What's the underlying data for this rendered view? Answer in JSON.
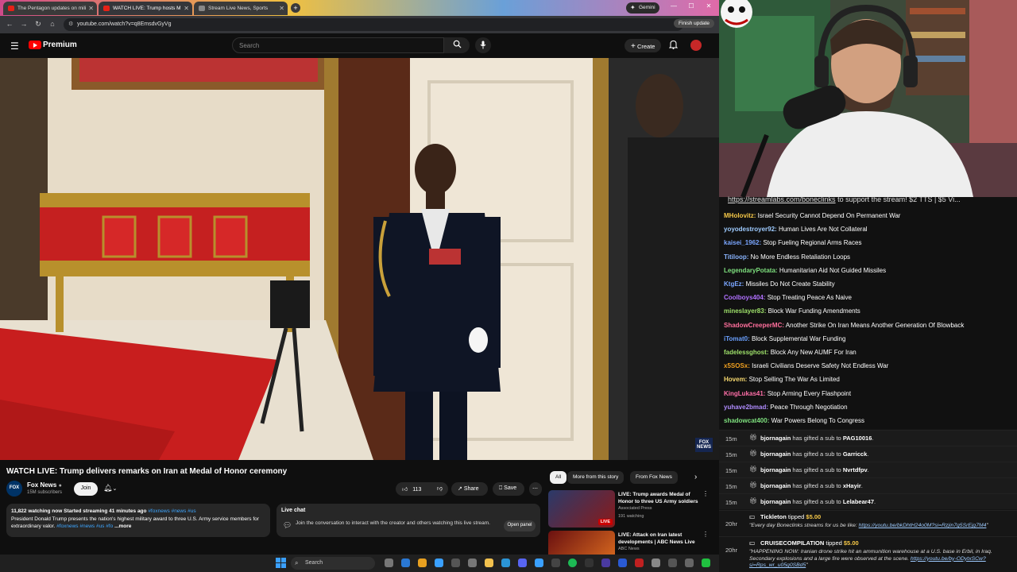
{
  "browser": {
    "tabs": [
      {
        "label": "The Pentagon updates on mili"
      },
      {
        "label": "WATCH LIVE: Trump hosts M"
      },
      {
        "label": "Stream Live News, Sports"
      }
    ],
    "gemini_label": "Gemini",
    "url": "youtube.com/watch?v=q8EmsdvGyVg",
    "finish_update": "Finish update"
  },
  "youtube": {
    "logo_text": "Premium",
    "search_placeholder": "Search",
    "create_label": "Create",
    "video": {
      "title": "WATCH LIVE: Trump delivers remarks on Iran at Medal of Honor ceremony",
      "channel": "Fox News",
      "subscribers": "15M subscribers",
      "join_label": "Join",
      "likes": "113",
      "share_label": "Share",
      "save_label": "Save",
      "description_meta": "11,822 watching now  Started streaming 41 minutes ago",
      "description_meta_tags": "#foxnews #news #us",
      "description_text": "President Donald Trump presents the nation's highest military award to three U.S. Army service members for extraordinary valor.",
      "description_tags": "#foxnews #news #us #fo",
      "description_more": "...more",
      "bug_text": "FOX NEWS"
    },
    "live_chat": {
      "title": "Live chat",
      "text": "Join the conversation to interact with the creator and others watching this live stream.",
      "open_panel": "Open panel"
    },
    "chips": [
      "All",
      "More from this story",
      "From Fox News"
    ],
    "recommendations": [
      {
        "title": "LIVE: Trump awards Medal of Honor to three US Army soldiers",
        "channel": "Associated Press",
        "watching": "191 watching",
        "badge": "LIVE"
      },
      {
        "title": "LIVE: Attack on Iran latest developments | ABC News Live",
        "channel": "ABC News",
        "watching": "",
        "badge": ""
      }
    ]
  },
  "taskbar": {
    "search_label": "Search"
  },
  "stream_chat": {
    "banner_link": "https://streamlabs.com/boneclinks",
    "banner_text": " to support the stream! $2 TTS | $5 Vi...",
    "messages": [
      {
        "user": "MHolovitz:",
        "text": "Israel Security Cannot Depend On Permanent War",
        "color": "#f7c948"
      },
      {
        "user": "yoyodestroyer92:",
        "text": "Human Lives Are Not Collateral",
        "color": "#9ecbff"
      },
      {
        "user": "kaisei_1962:",
        "text": "Stop Fueling Regional Arms Races",
        "color": "#7aa6ff"
      },
      {
        "user": "Titiloop:",
        "text": "No More Endless Retaliation Loops",
        "color": "#8ab4ff"
      },
      {
        "user": "LegendaryPotata:",
        "text": "Humanitarian Aid Not Guided Missiles",
        "color": "#7ee07e"
      },
      {
        "user": "KtgEz:",
        "text": "Missiles Do Not Create Stability",
        "color": "#7aa6ff"
      },
      {
        "user": "Coolboys404:",
        "text": "Stop Treating Peace As Naive",
        "color": "#b070ff"
      },
      {
        "user": "mineslayer83:",
        "text": "Block War Funding Amendments",
        "color": "#9ee06a"
      },
      {
        "user": "ShadowCreeperMC:",
        "text": "Another Strike On Iran Means Another Generation Of Blowback",
        "color": "#ff6f9c"
      },
      {
        "user": "iTomat0:",
        "text": "Block Supplemental War Funding",
        "color": "#6aa0ff"
      },
      {
        "user": "fadelessghost:",
        "text": "Block Any New AUMF For Iran",
        "color": "#9ee06a"
      },
      {
        "user": "x5SOSx:",
        "text": "Israeli Civilians Deserve Safety Not Endless War",
        "color": "#f0a020"
      },
      {
        "user": "Hovem:",
        "text": "Stop Selling The War As Limited",
        "color": "#f5d76e"
      },
      {
        "user": "KingLukas41:",
        "text": "Stop Arming Every Flashpoint",
        "color": "#ff6fa8"
      },
      {
        "user": "yuhave2bmad:",
        "text": "Peace Through Negotiation",
        "color": "#b08cff"
      },
      {
        "user": "shadowcat400:",
        "text": "War Powers Belong To Congress",
        "color": "#7ee07e"
      }
    ]
  },
  "alerts": {
    "gifts": [
      {
        "time": "15m",
        "user": "bjornagain",
        "mid": " has gifted a sub to ",
        "to": "PAG10016",
        "end": "."
      },
      {
        "time": "15m",
        "user": "bjornagain",
        "mid": " has gifted a sub to ",
        "to": "Garricck",
        "end": "."
      },
      {
        "time": "15m",
        "user": "bjornagain",
        "mid": " has gifted a sub to ",
        "to": "Nvrtdfpv",
        "end": "."
      },
      {
        "time": "15m",
        "user": "bjornagain",
        "mid": " has gifted a sub to ",
        "to": "xHayir",
        "end": "."
      },
      {
        "time": "15m",
        "user": "bjornagain",
        "mid": " has gifted a sub to ",
        "to": "Lelabear47",
        "end": "."
      }
    ],
    "tips": [
      {
        "time": "20hr",
        "user": "Tickleton",
        "verb": " tipped ",
        "amount": "$5.00",
        "body": "\"Every day Boneclinks streams for us be like: ",
        "link": "https://youtu.be/bkDhtH24o0M?si=Rzjin7g5SrEjg7M4",
        "close": "\""
      },
      {
        "time": "20hr",
        "user": "CRUISECOMPILATION",
        "verb": " tipped ",
        "amount": "$5.00",
        "body": "\"HAPPENING NOW: Iranian drone strike hit an ammunition warehouse at a U.S. base in Erbil, in Iraq. Secondary explosions and a large fire were observed at the scene. ",
        "link": "https://youtu.be/by-ODytxSCw?si=Rps_wr_u05g0SBd5",
        "close": "\""
      }
    ]
  }
}
